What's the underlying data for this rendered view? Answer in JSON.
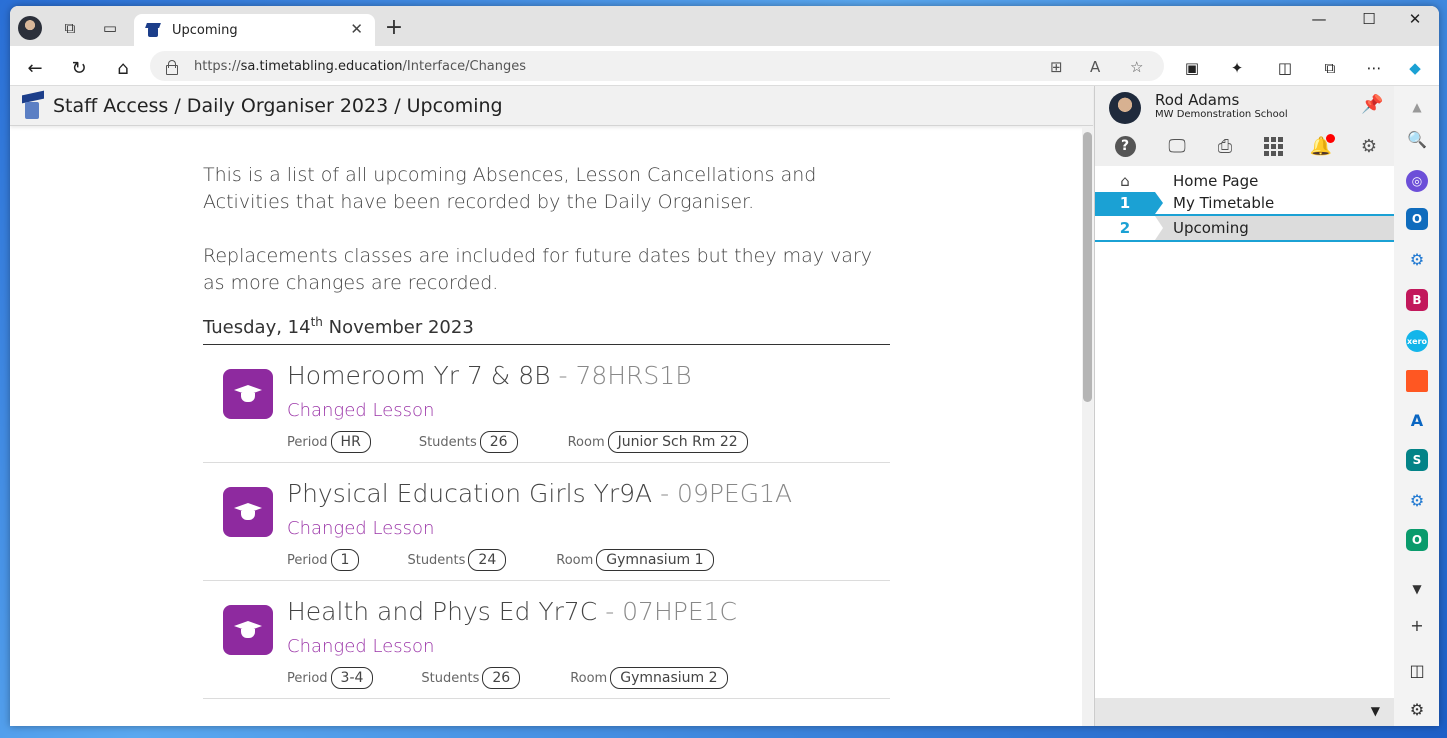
{
  "browser": {
    "tab_title": "Upcoming",
    "tab_close": "✕",
    "new_tab": "+",
    "url_prefix": "https://",
    "url_host": "sa.timetabling.education",
    "url_path": "/Interface/Changes",
    "win_minimize": "—",
    "win_maximize": "☐",
    "win_close": "✕"
  },
  "header": {
    "breadcrumb": "Staff Access / Daily Organiser 2023 / Upcoming"
  },
  "intro": {
    "line1": "This is a list of all upcoming Absences, Lesson Cancellations and Activities that have been recorded by the Daily Organiser.",
    "line2": "Replacements classes are included for future dates but they may vary as more changes are recorded."
  },
  "date": {
    "prefix": "Tuesday, 14",
    "suffix": "th",
    "rest": " November 2023"
  },
  "labels": {
    "period": "Period",
    "students": "Students",
    "room": "Room"
  },
  "entries": [
    {
      "name": "Homeroom Yr 7 & 8B",
      "code": "78HRS1B",
      "status": "Changed Lesson",
      "period": "HR",
      "students": "26",
      "room": "Junior Sch Rm 22"
    },
    {
      "name": "Physical Education Girls Yr9A",
      "code": "09PEG1A",
      "status": "Changed Lesson",
      "period": "1",
      "students": "24",
      "room": "Gymnasium 1"
    },
    {
      "name": "Health and Phys Ed Yr7C",
      "code": "07HPE1C",
      "status": "Changed Lesson",
      "period": "3-4",
      "students": "26",
      "room": "Gymnasium 2"
    }
  ],
  "panel": {
    "user_name": "Rod Adams",
    "school": "MW Demonstration School",
    "menu": [
      {
        "badge": "⌂",
        "label": "Home Page"
      },
      {
        "badge": "1",
        "label": "My Timetable"
      },
      {
        "badge": "2",
        "label": "Upcoming"
      }
    ]
  },
  "colors": {
    "accent": "#1ba1d4",
    "entry_icon": "#8e2a9f",
    "status_text": "#9b35a8"
  }
}
